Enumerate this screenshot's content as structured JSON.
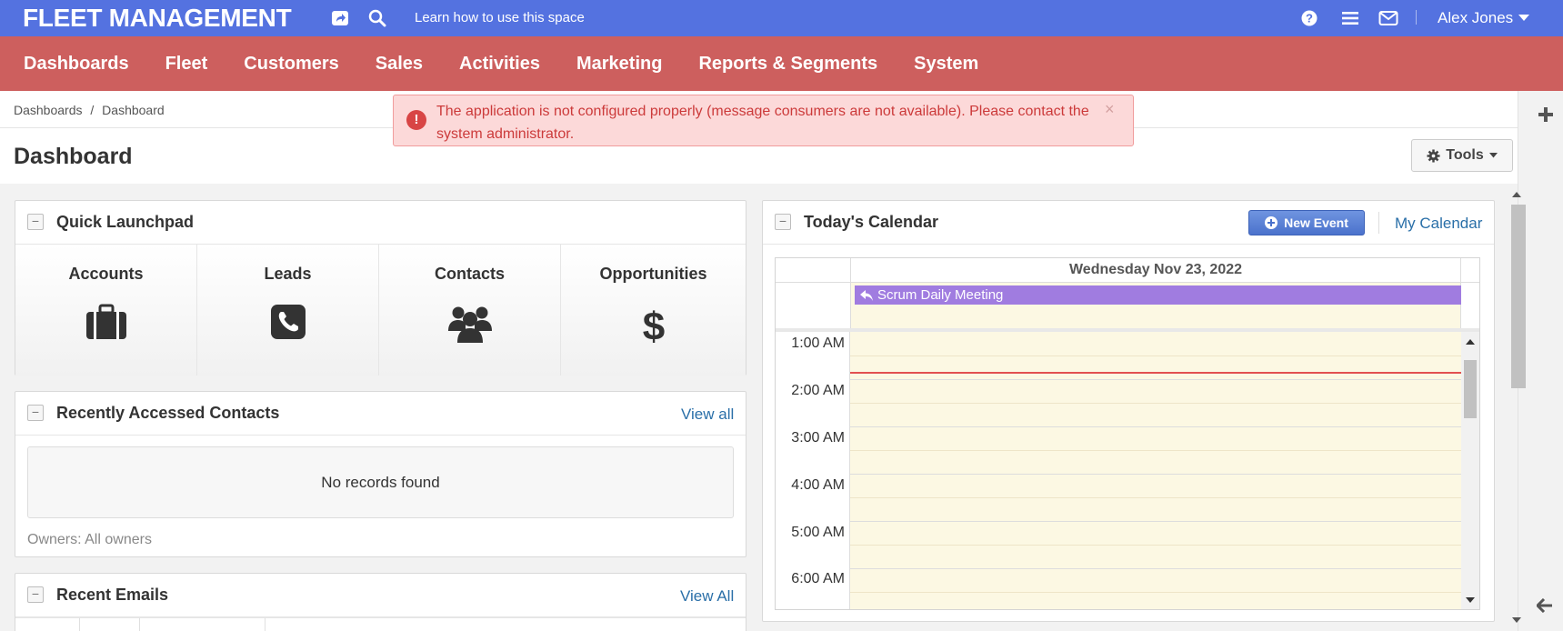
{
  "topbar": {
    "brand": "FLEET MANAGEMENT",
    "learn_link": "Learn how to use this space",
    "user_name": "Alex Jones"
  },
  "nav": {
    "items": [
      "Dashboards",
      "Fleet",
      "Customers",
      "Sales",
      "Activities",
      "Marketing",
      "Reports & Segments",
      "System"
    ]
  },
  "header": {
    "breadcrumb_1": "Dashboards",
    "breadcrumb_sep": "/",
    "breadcrumb_2": "Dashboard",
    "title": "Dashboard",
    "tools_label": "Tools"
  },
  "alert": {
    "message": "The application is not configured properly (message consumers are not available). Please contact the system administrator.",
    "close": "×"
  },
  "launchpad": {
    "title": "Quick Launchpad",
    "tiles": [
      {
        "label": "Accounts",
        "icon": "briefcase-icon"
      },
      {
        "label": "Leads",
        "icon": "phone-icon"
      },
      {
        "label": "Contacts",
        "icon": "users-icon"
      },
      {
        "label": "Opportunities",
        "icon": "dollar-icon"
      }
    ]
  },
  "recent_contacts": {
    "title": "Recently Accessed Contacts",
    "view_all": "View all",
    "empty": "No records found",
    "owners": "Owners: All owners"
  },
  "recent_emails": {
    "title": "Recent Emails",
    "view_all": "View All"
  },
  "calendar": {
    "title": "Today's Calendar",
    "new_event": "New Event",
    "my_calendar": "My Calendar",
    "date": "Wednesday Nov 23, 2022",
    "event": "Scrum Daily Meeting",
    "times": [
      "1:00 AM",
      "2:00 AM",
      "3:00 AM",
      "4:00 AM",
      "5:00 AM",
      "6:00 AM"
    ]
  },
  "colors": {
    "topbar": "#5472e0",
    "navbar": "#cd5f5e",
    "event": "#a07ce0",
    "alert_bg": "#fcd9d9",
    "link": "#2a6fa8"
  }
}
